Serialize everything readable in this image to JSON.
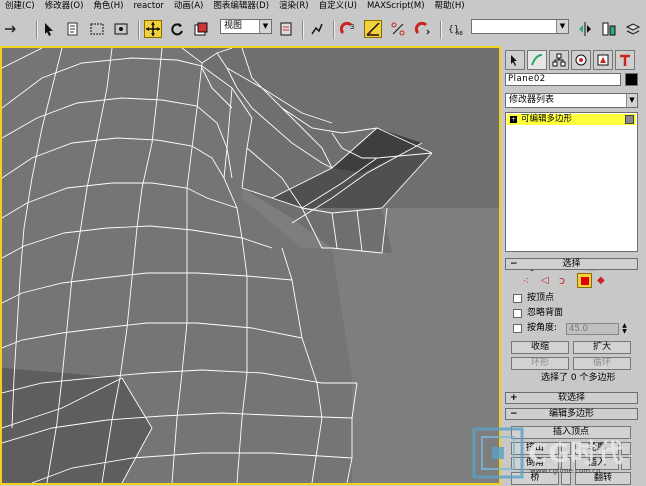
{
  "menubar": {
    "items": [
      "创建(C)",
      "修改器(O)",
      "角色(H)",
      "reactor",
      "动画(A)",
      "图表编辑器(D)",
      "渲染(R)",
      "自定义(U)",
      "MAXScript(M)",
      "帮助(H)"
    ]
  },
  "toolbar": {
    "view_dropdown": "视图",
    "named_selection_dropdown": "",
    "icons": [
      "undo-icon",
      "redo-icon",
      "select-link-icon",
      "unlink-icon",
      "bind-space-warp-icon",
      "select-object-icon",
      "select-by-name-icon",
      "rect-region-icon",
      "window-crossing-icon",
      "select-move-icon",
      "select-rotate-icon",
      "select-scale-icon",
      "use-pivot-icon",
      "mirror-icon",
      "align-icon",
      "snap-icon",
      "angle-snap-icon",
      "percent-snap-icon",
      "spinner-snap-icon",
      "edit-named-selection-icon",
      "mirror-tool-icon",
      "align-tool-icon"
    ]
  },
  "viewport": {
    "border_color": "#f0d020",
    "background": "#7e7e7e"
  },
  "panel": {
    "tabs": [
      "create-tab",
      "modify-tab",
      "hierarchy-tab",
      "motion-tab",
      "display-tab",
      "utilities-tab"
    ],
    "object_name": "Plane02",
    "object_color": "#000000",
    "modifier_list": "修改器列表",
    "stack_item": "可编辑多边形",
    "selection": {
      "title": "选择",
      "by_vertex": "按顶点",
      "ignore_backfacing": "忽略背面",
      "by_angle": "按角度:",
      "angle_value": "45.0",
      "shrink": "收缩",
      "grow": "扩大",
      "ring": "环形",
      "loop": "循环",
      "status": "选择了 0 个多边形"
    },
    "soft_selection": {
      "title": "软选择"
    },
    "edit_polygons": {
      "title": "编辑多边形",
      "insert_vertex": "插入顶点",
      "extrude": "挤出",
      "bevel": "倒角",
      "outline": "轮廓",
      "inset": "插入",
      "bridge": "桥",
      "flip": "翻转"
    }
  },
  "watermark": {
    "text": "CG时代",
    "url": "www.cgtime.com.cn"
  }
}
